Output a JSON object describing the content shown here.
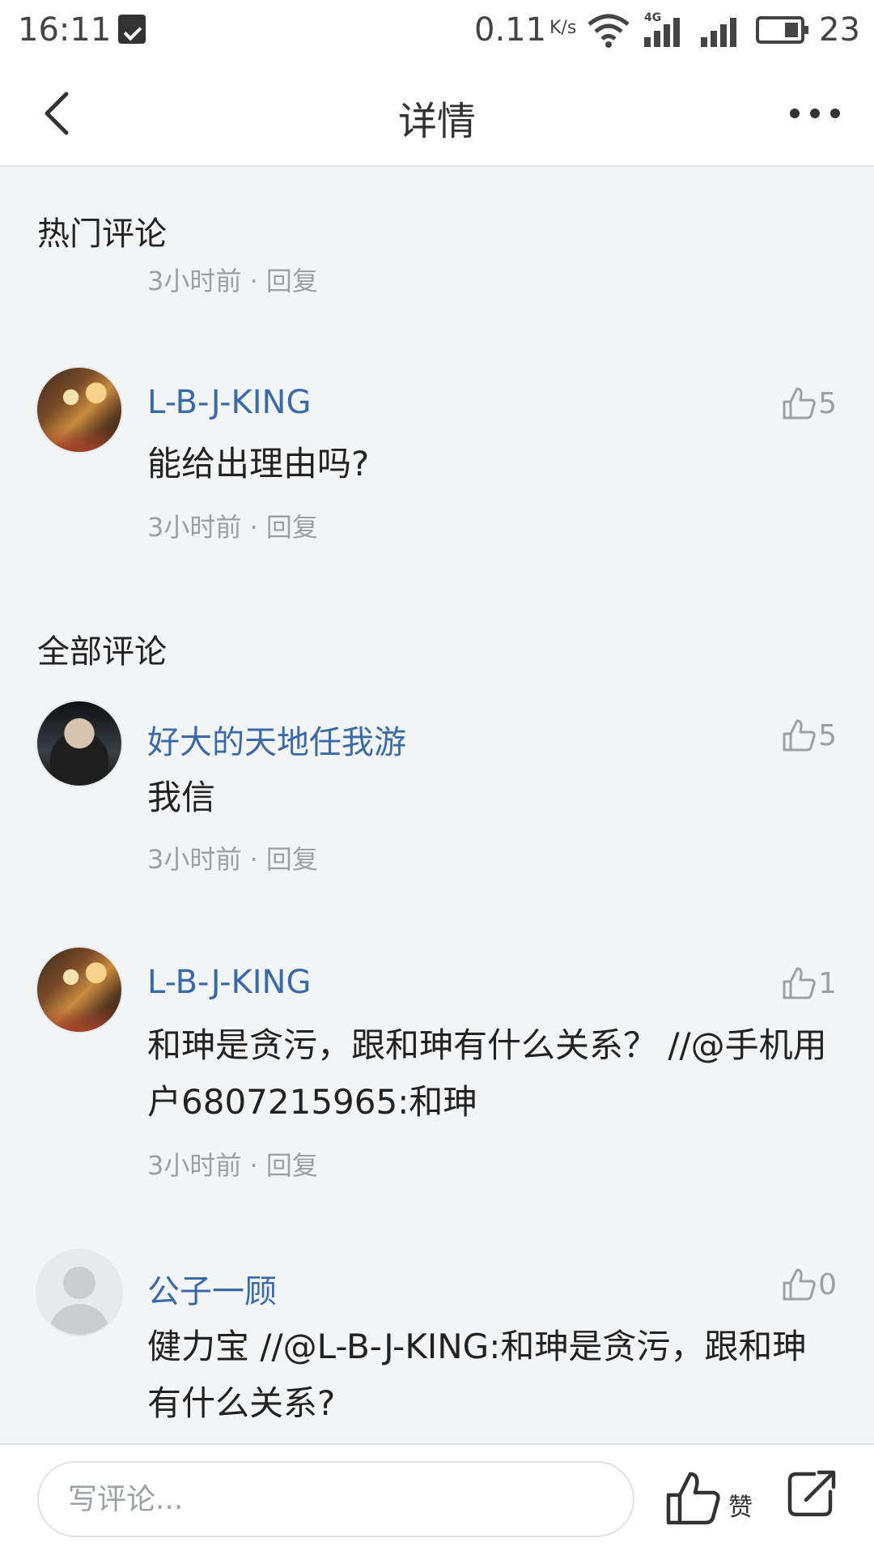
{
  "status_bar": {
    "time": "16:11",
    "speed": "0.11",
    "speed_unit": "K/s",
    "network": "4G",
    "battery": "23"
  },
  "header": {
    "title": "详情"
  },
  "sections": {
    "hot": "热门评论",
    "all": "全部评论"
  },
  "top_meta": {
    "time": "3小时前",
    "separator": " · ",
    "reply": "回复"
  },
  "comments": [
    {
      "user": "L-B-J-KING",
      "text": "能给出理由吗?",
      "likes": "5",
      "time": "3小时前",
      "reply": "回复"
    },
    {
      "user": "好大的天地任我游",
      "text": "我信",
      "likes": "5",
      "time": "3小时前",
      "reply": "回复"
    },
    {
      "user": "L-B-J-KING",
      "text": "和珅是贪污，跟和珅有什么关系？ //@手机用户6807215965:和珅",
      "likes": "1",
      "time": "3小时前",
      "reply": "回复"
    },
    {
      "user": "公子一顾",
      "text": "健力宝 //@L-B-J-KING:和珅是贪污，跟和珅有什么关系?",
      "likes": "0"
    }
  ],
  "bottom_bar": {
    "placeholder": "写评论...",
    "like_label": "赞"
  },
  "colors": {
    "username": "#3b6aa8",
    "background": "#f2f4f5",
    "meta": "#9aa0a4"
  }
}
